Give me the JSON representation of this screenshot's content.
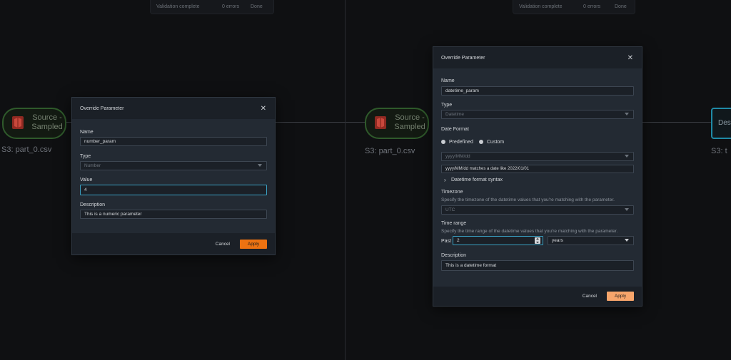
{
  "validation_bar": {
    "status": "Validation complete",
    "errors": "0 errors",
    "action": "Done"
  },
  "canvas": {
    "source_node": {
      "label_line1": "Source -",
      "label_line2": "Sampled",
      "caption": "S3: part_0.csv"
    },
    "dest_node": {
      "label": "Dest",
      "caption": "S3: t"
    }
  },
  "left_modal": {
    "title": "Override Parameter",
    "name_label": "Name",
    "name_value": "number_param",
    "type_label": "Type",
    "type_value": "Number",
    "value_label": "Value",
    "value_value": "4",
    "description_label": "Description",
    "description_value": "This is a numeric parameter",
    "cancel": "Cancel",
    "apply": "Apply"
  },
  "right_modal": {
    "title": "Override Parameter",
    "name_label": "Name",
    "name_value": "datetime_param",
    "type_label": "Type",
    "type_value": "Datetime",
    "date_format_label": "Date Format",
    "option_predefined": "Predefined",
    "option_custom": "Custom",
    "format_value": "yyyy/MM/dd",
    "format_example": "yyyy/MM/dd matches a date like 2022/01/01",
    "syntax_toggle": "Datetime format syntax",
    "timezone_label": "Timezone",
    "timezone_hint": "Specify the timezone of the datetime values that you're matching with the parameter.",
    "timezone_value": "UTC",
    "time_range_label": "Time range",
    "time_range_hint": "Specify the time range of the datetime values that you're matching with the parameter.",
    "past_label": "Past",
    "past_value": "2",
    "unit_value": "years",
    "description_label": "Description",
    "description_value": "This is a datetime format",
    "cancel": "Cancel",
    "apply": "Apply"
  },
  "colors": {
    "accent": "#ec7211",
    "focus": "#3aa0c2",
    "node_border": "#2f5a2b",
    "dest_border": "#1f8aa6"
  },
  "icons": {
    "close": "close-icon",
    "source": "s3-bucket-icon",
    "chevron": "chevron-right-icon"
  }
}
